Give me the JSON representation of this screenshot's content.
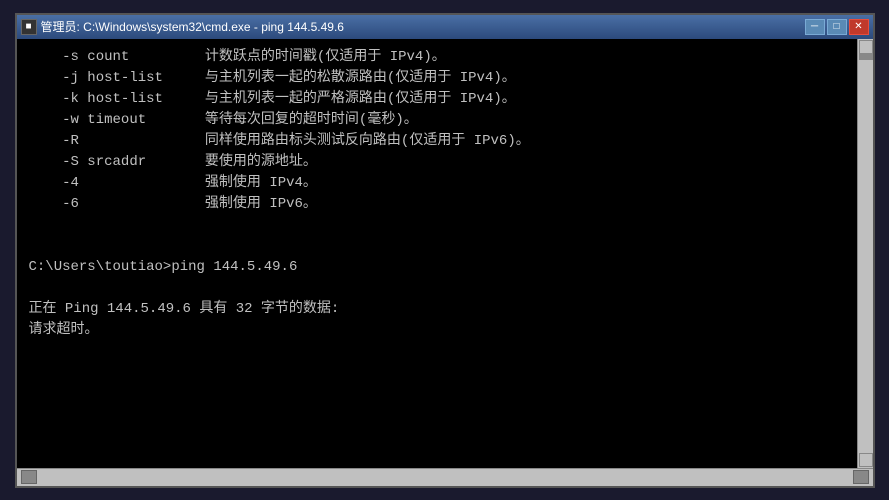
{
  "window": {
    "title": "管理员: C:\\Windows\\system32\\cmd.exe - ping  144.5.49.6",
    "title_icon": "■"
  },
  "titlebar": {
    "minimize_label": "─",
    "maximize_label": "□",
    "close_label": "✕"
  },
  "console": {
    "lines": [
      {
        "text": "    -s count         计数跃点的时间戳(仅适用于 IPv4)。"
      },
      {
        "text": "    -j host-list     与主机列表一起的松散源路由(仅适用于 IPv4)。"
      },
      {
        "text": "    -k host-list     与主机列表一起的严格源路由(仅适用于 IPv4)。"
      },
      {
        "text": "    -w timeout       等待每次回复的超时时间(毫秒)。"
      },
      {
        "text": "    -R               同样使用路由标头测试反向路由(仅适用于 IPv6)。"
      },
      {
        "text": "    -S srcaddr       要使用的源地址。"
      },
      {
        "text": "    -4               强制使用 IPv4。"
      },
      {
        "text": "    -6               强制使用 IPv6。"
      },
      {
        "text": ""
      },
      {
        "text": ""
      },
      {
        "text": "C:\\Users\\toutiao>ping 144.5.49.6"
      },
      {
        "text": ""
      },
      {
        "text": "正在 Ping 144.5.49.6 具有 32 字节的数据:"
      },
      {
        "text": "请求超时。"
      }
    ]
  },
  "statusbar": {
    "left_arrow": "◄",
    "right_arrow": "►"
  }
}
